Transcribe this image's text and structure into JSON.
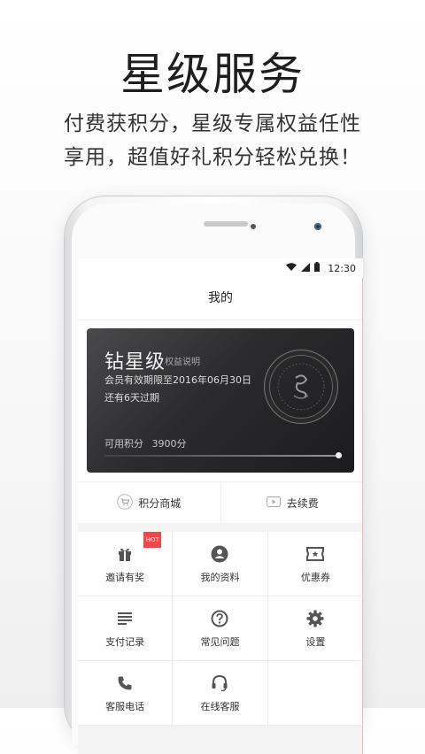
{
  "promo": {
    "title": "星级服务",
    "subtitle_line1": "付费获积分，星级专属权益任性",
    "subtitle_line2": "享用，超值好礼积分轻松兑换！"
  },
  "status_bar": {
    "time": "12:30"
  },
  "app": {
    "title": "我的"
  },
  "vip_card": {
    "level": "钻星级",
    "help_link": "权益说明",
    "valid_until": "会员有效期限至2016年06月30日",
    "expire_note": "还有6天过期",
    "points_label": "可用积分",
    "points_value": "3900分"
  },
  "quick_actions": [
    {
      "label": "积分商城",
      "icon": "cart-icon"
    },
    {
      "label": "去续费",
      "icon": "renew-icon"
    }
  ],
  "grid": [
    {
      "label": "邀请有奖",
      "icon": "gift-icon",
      "badge": "HOT"
    },
    {
      "label": "我的资料",
      "icon": "profile-icon"
    },
    {
      "label": "优惠券",
      "icon": "coupon-icon"
    },
    {
      "label": "支付记录",
      "icon": "list-icon"
    },
    {
      "label": "常见问题",
      "icon": "help-icon"
    },
    {
      "label": "设置",
      "icon": "gear-icon"
    },
    {
      "label": "客服电话",
      "icon": "phone-icon"
    },
    {
      "label": "在线客服",
      "icon": "headset-icon"
    },
    {
      "label": "",
      "icon": ""
    }
  ],
  "colors": {
    "accent_red": "#f04848",
    "card_dark": "#2b2b2d"
  }
}
